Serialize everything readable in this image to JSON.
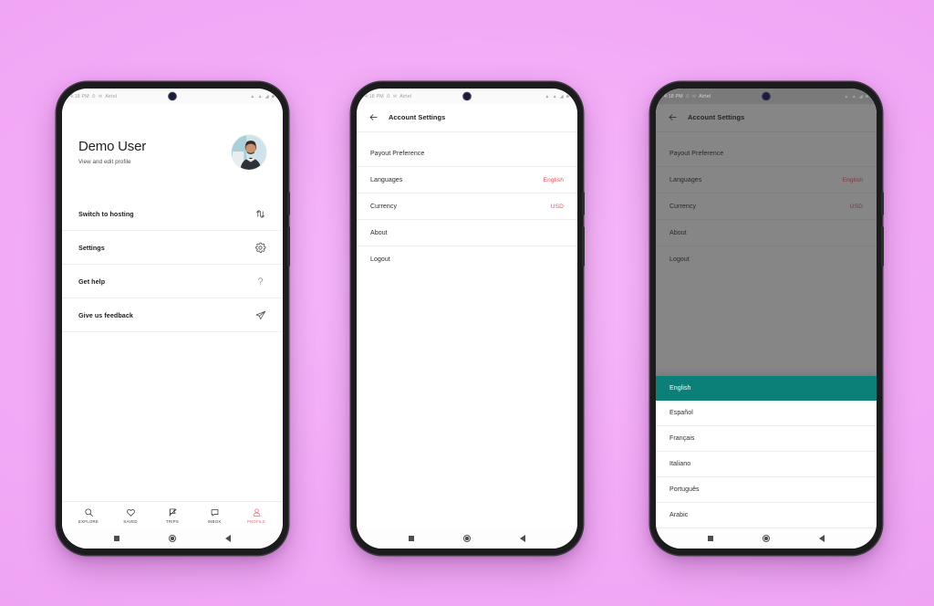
{
  "background": {
    "gradient_from": "#f7b9fa",
    "gradient_to": "#eaa0ee"
  },
  "colors": {
    "accent_red": "#e8505b",
    "teal_selected": "#0b8078",
    "tab_active": "#ef6b72",
    "text_primary": "#1d1d1d",
    "divider": "#ededed"
  },
  "status_bar": {
    "time": "4:18 PM",
    "left_icons": [
      "alarm-icon",
      "message-icon"
    ],
    "carrier": "Airtel",
    "right_icons": [
      "signal-icon",
      "signal-icon",
      "wifi-icon",
      "battery-icon"
    ]
  },
  "android_nav": {
    "recents_label": "recents",
    "home_label": "home",
    "back_label": "back"
  },
  "phone1": {
    "screen_name": "Profile",
    "profile": {
      "name": "Demo User",
      "subtitle": "View and edit profile",
      "avatar_alt": "user-avatar"
    },
    "menu": [
      {
        "label": "Switch to hosting",
        "icon": "swap-arrows-icon"
      },
      {
        "label": "Settings",
        "icon": "gear-icon"
      },
      {
        "label": "Get help",
        "icon": "question-mark-icon"
      },
      {
        "label": "Give us feedback",
        "icon": "paper-plane-icon"
      }
    ],
    "tabs": [
      {
        "label": "EXPLORE",
        "icon": "search-icon",
        "active": false
      },
      {
        "label": "SAVED",
        "icon": "heart-icon",
        "active": false
      },
      {
        "label": "TRIPS",
        "icon": "flag-icon",
        "active": false
      },
      {
        "label": "INBOX",
        "icon": "chat-bubble-icon",
        "active": false
      },
      {
        "label": "PROFILE",
        "icon": "person-icon",
        "active": true
      }
    ]
  },
  "phone2": {
    "screen_name": "Account Settings",
    "appbar": {
      "title": "Account Settings",
      "back_icon": "back-arrow-icon"
    },
    "rows": [
      {
        "label": "Payout Preference",
        "value": ""
      },
      {
        "label": "Languages",
        "value": "English"
      },
      {
        "label": "Currency",
        "value": "USD"
      },
      {
        "label": "About",
        "value": ""
      },
      {
        "label": "Logout",
        "value": ""
      }
    ]
  },
  "phone3": {
    "screen_name": "Account Settings with language picker",
    "appbar": {
      "title": "Account Settings",
      "back_icon": "back-arrow-icon"
    },
    "rows": [
      {
        "label": "Payout Preference",
        "value": ""
      },
      {
        "label": "Languages",
        "value": "English"
      },
      {
        "label": "Currency",
        "value": "USD"
      },
      {
        "label": "About",
        "value": ""
      },
      {
        "label": "Logout",
        "value": ""
      }
    ],
    "language_sheet": {
      "selected": "English",
      "options": [
        {
          "label": "English",
          "selected": true
        },
        {
          "label": "Español",
          "selected": false
        },
        {
          "label": "Français",
          "selected": false
        },
        {
          "label": "Italiano",
          "selected": false
        },
        {
          "label": "Português",
          "selected": false
        },
        {
          "label": "Arabic",
          "selected": false
        }
      ]
    }
  }
}
